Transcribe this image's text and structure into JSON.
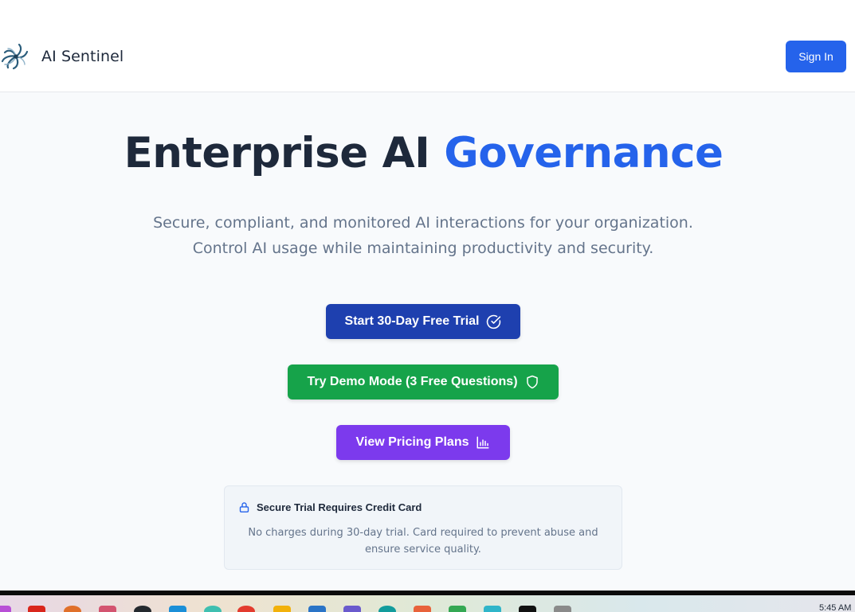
{
  "header": {
    "brand": "AI Sentinel",
    "sign_in_label": "Sign In"
  },
  "hero": {
    "title_main": "Enterprise AI",
    "title_accent": "Governance",
    "subtitle": "Secure, compliant, and monitored AI interactions for your organization. Control AI usage while maintaining productivity and security."
  },
  "actions": {
    "trial_label": "Start 30-Day Free Trial",
    "demo_label": "Try Demo Mode (3 Free Questions)",
    "pricing_label": "View Pricing Plans"
  },
  "notice": {
    "title": "Secure Trial Requires Credit Card",
    "body": "No charges during 30-day trial. Card required to prevent abuse and ensure service quality."
  },
  "taskbar": {
    "clock": "5:45 AM"
  },
  "colors": {
    "accent": "#2563eb",
    "trial": "#1e40af",
    "demo": "#16a34a",
    "pricing": "#7c3aed"
  },
  "icons": {
    "logo": "spiral-logo-icon",
    "trial": "check-circle-icon",
    "demo": "shield-icon",
    "pricing": "bar-chart-icon",
    "notice": "lock-icon"
  }
}
